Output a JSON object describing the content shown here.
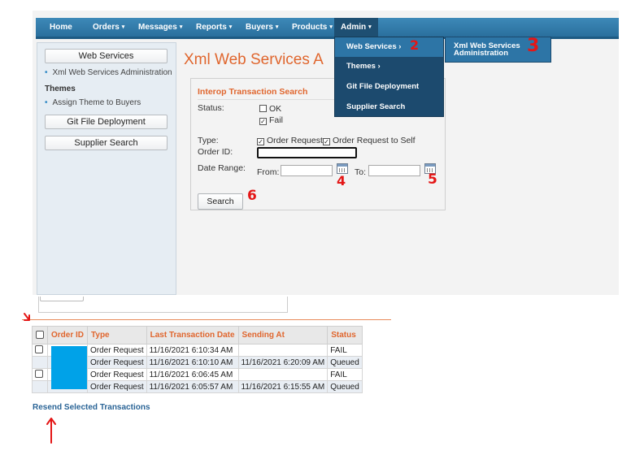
{
  "nav": {
    "items": [
      {
        "label": "Home",
        "caret": false
      },
      {
        "label": "Orders",
        "caret": true
      },
      {
        "label": "Messages",
        "caret": true
      },
      {
        "label": "Reports",
        "caret": true
      },
      {
        "label": "Buyers",
        "caret": true
      },
      {
        "label": "Products",
        "caret": true
      },
      {
        "label": "Admin",
        "caret": true
      }
    ],
    "caret_glyph": "▾"
  },
  "admin_menu": {
    "items": [
      {
        "label": "Web Services ›",
        "highlighted": true
      },
      {
        "label": "Themes ›",
        "highlighted": false
      },
      {
        "label": "Git File Deployment",
        "highlighted": false
      },
      {
        "label": "Supplier Search",
        "highlighted": false
      }
    ],
    "submenu": {
      "line1": "Xml Web Services",
      "line2": "Administration"
    }
  },
  "sidebar": {
    "web_services_button": "Web Services",
    "xml_admin_link": "Xml Web Services Administration",
    "themes_title": "Themes",
    "assign_theme_link": "Assign Theme to Buyers",
    "git_button": "Git File Deployment",
    "supplier_button": "Supplier Search"
  },
  "page_title": "Xml Web Services A",
  "search": {
    "panel_title": "Interop Transaction Search",
    "status_label": "Status:",
    "ok_label": "OK",
    "ok_checked": false,
    "fail_label": "Fail",
    "fail_checked": true,
    "type_label": "Type:",
    "type_order_request": "Order Request",
    "type_order_request_self": "Order Request to Self",
    "order_id_label": "Order ID:",
    "order_id_value": "",
    "date_range_label": "Date Range:",
    "from_label": "From:",
    "to_label": "To:",
    "from_value": "",
    "to_value": "",
    "search_button": "Search"
  },
  "annotations": {
    "n2": "2",
    "n3": "3",
    "n4": "4",
    "n5": "5",
    "n6": "6",
    "color": "#e41616"
  },
  "results": {
    "headers": [
      "Order ID",
      "Type",
      "Last Transaction Date",
      "Sending At",
      "Status"
    ],
    "rows": [
      {
        "checkbox": true,
        "order_id": "",
        "type": "Order Request",
        "last_date": "11/16/2021 6:10:34 AM",
        "sending_at": "",
        "status": "FAIL"
      },
      {
        "checkbox": false,
        "order_id": "",
        "type": "Order Request",
        "last_date": "11/16/2021 6:10:10 AM",
        "sending_at": "11/16/2021 6:20:09 AM",
        "status": "Queued"
      },
      {
        "checkbox": true,
        "order_id": "",
        "type": "Order Request",
        "last_date": "11/16/2021 6:06:45 AM",
        "sending_at": "",
        "status": "FAIL"
      },
      {
        "checkbox": false,
        "order_id": "",
        "type": "Order Request",
        "last_date": "11/16/2021 6:05:57 AM",
        "sending_at": "11/16/2021 6:15:55 AM",
        "status": "Queued"
      }
    ],
    "resend_link": "Resend Selected Transactions"
  },
  "colors": {
    "accent_orange": "#e0662e",
    "nav_blue": "#2d75a6",
    "menu_dark": "#1c4a6e",
    "redaction_blue": "#00a2e8"
  }
}
